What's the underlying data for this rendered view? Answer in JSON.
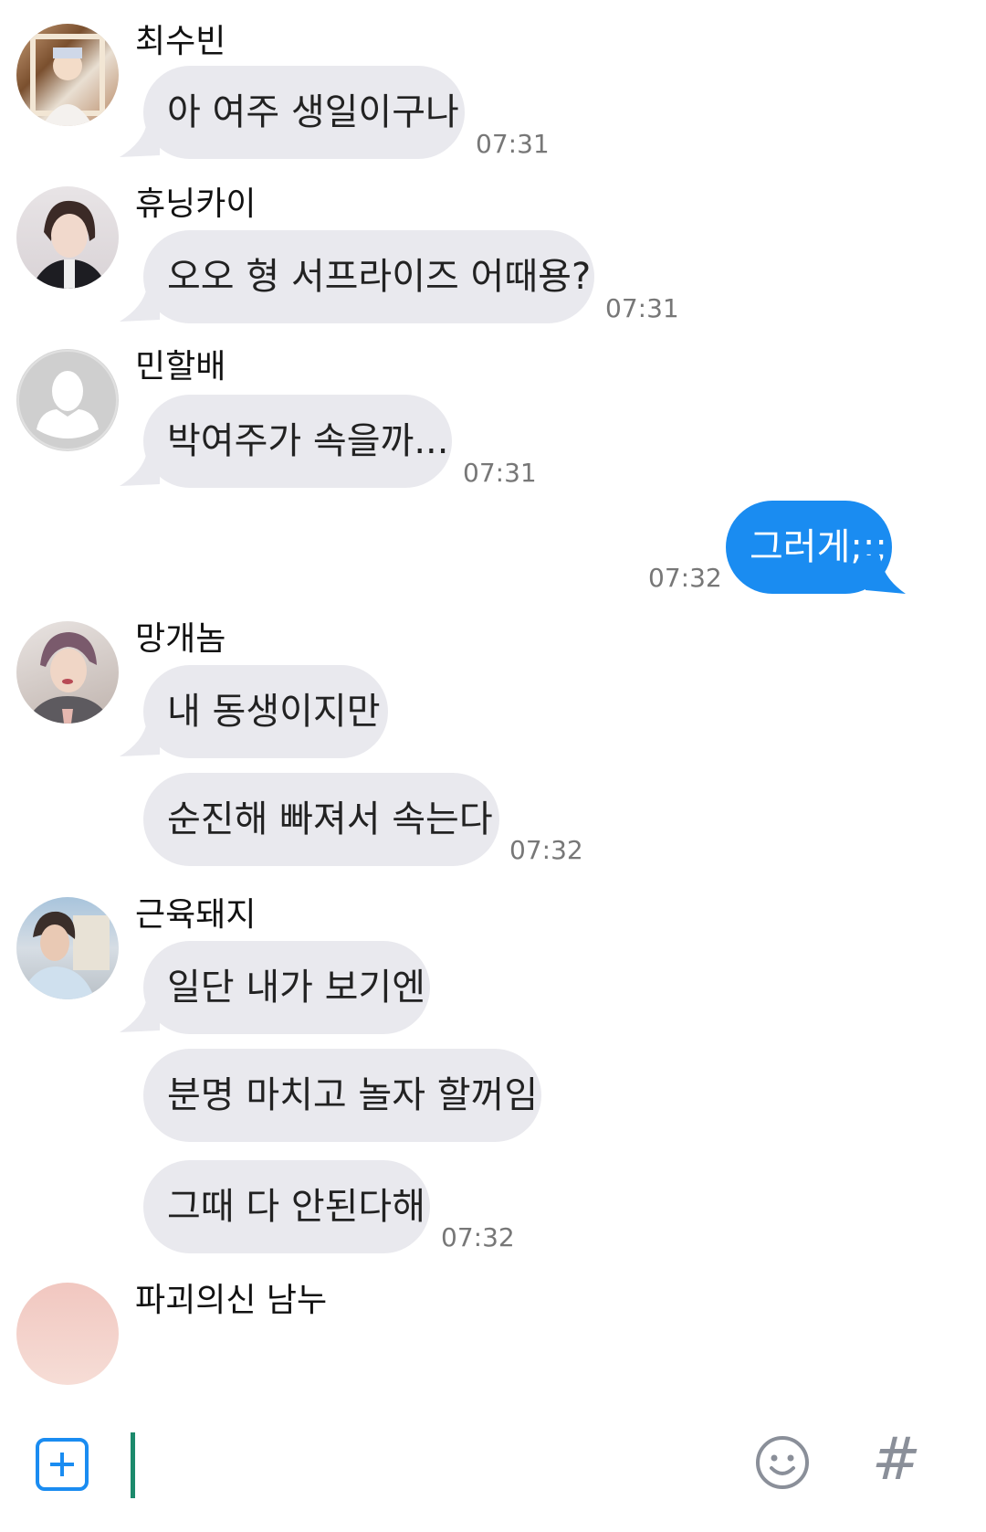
{
  "colors": {
    "incoming_bubble": "#e9e9ee",
    "outgoing_bubble": "#1a8cf1",
    "accent": "#1a8cf1",
    "cursor": "#1c8a6c"
  },
  "messages": [
    {
      "sender": "최수빈",
      "lines": [
        "아 여주 생일이구나"
      ],
      "time": "07:31"
    },
    {
      "sender": "휴닝카이",
      "lines": [
        "오오 형 서프라이즈 어때용?"
      ],
      "time": "07:31"
    },
    {
      "sender": "민할배",
      "lines": [
        "박여주가 속을까..."
      ],
      "time": "07:31"
    },
    {
      "outgoing": true,
      "text": "그러게;;;",
      "time": "07:32"
    },
    {
      "sender": "망개놈",
      "lines": [
        "내 동생이지만",
        "순진해 빠져서 속는다"
      ],
      "time": "07:32"
    },
    {
      "sender": "근육돼지",
      "lines": [
        "일단 내가 보기엔",
        "분명 마치고 놀자 할꺼임",
        "그때 다 안된다해"
      ],
      "time": "07:32"
    },
    {
      "sender": "파괴의신 남누",
      "partial": true
    }
  ],
  "composer": {
    "plus_icon": "plus-square-icon",
    "emoji_icon": "smiley-icon",
    "hash_label": "#"
  }
}
